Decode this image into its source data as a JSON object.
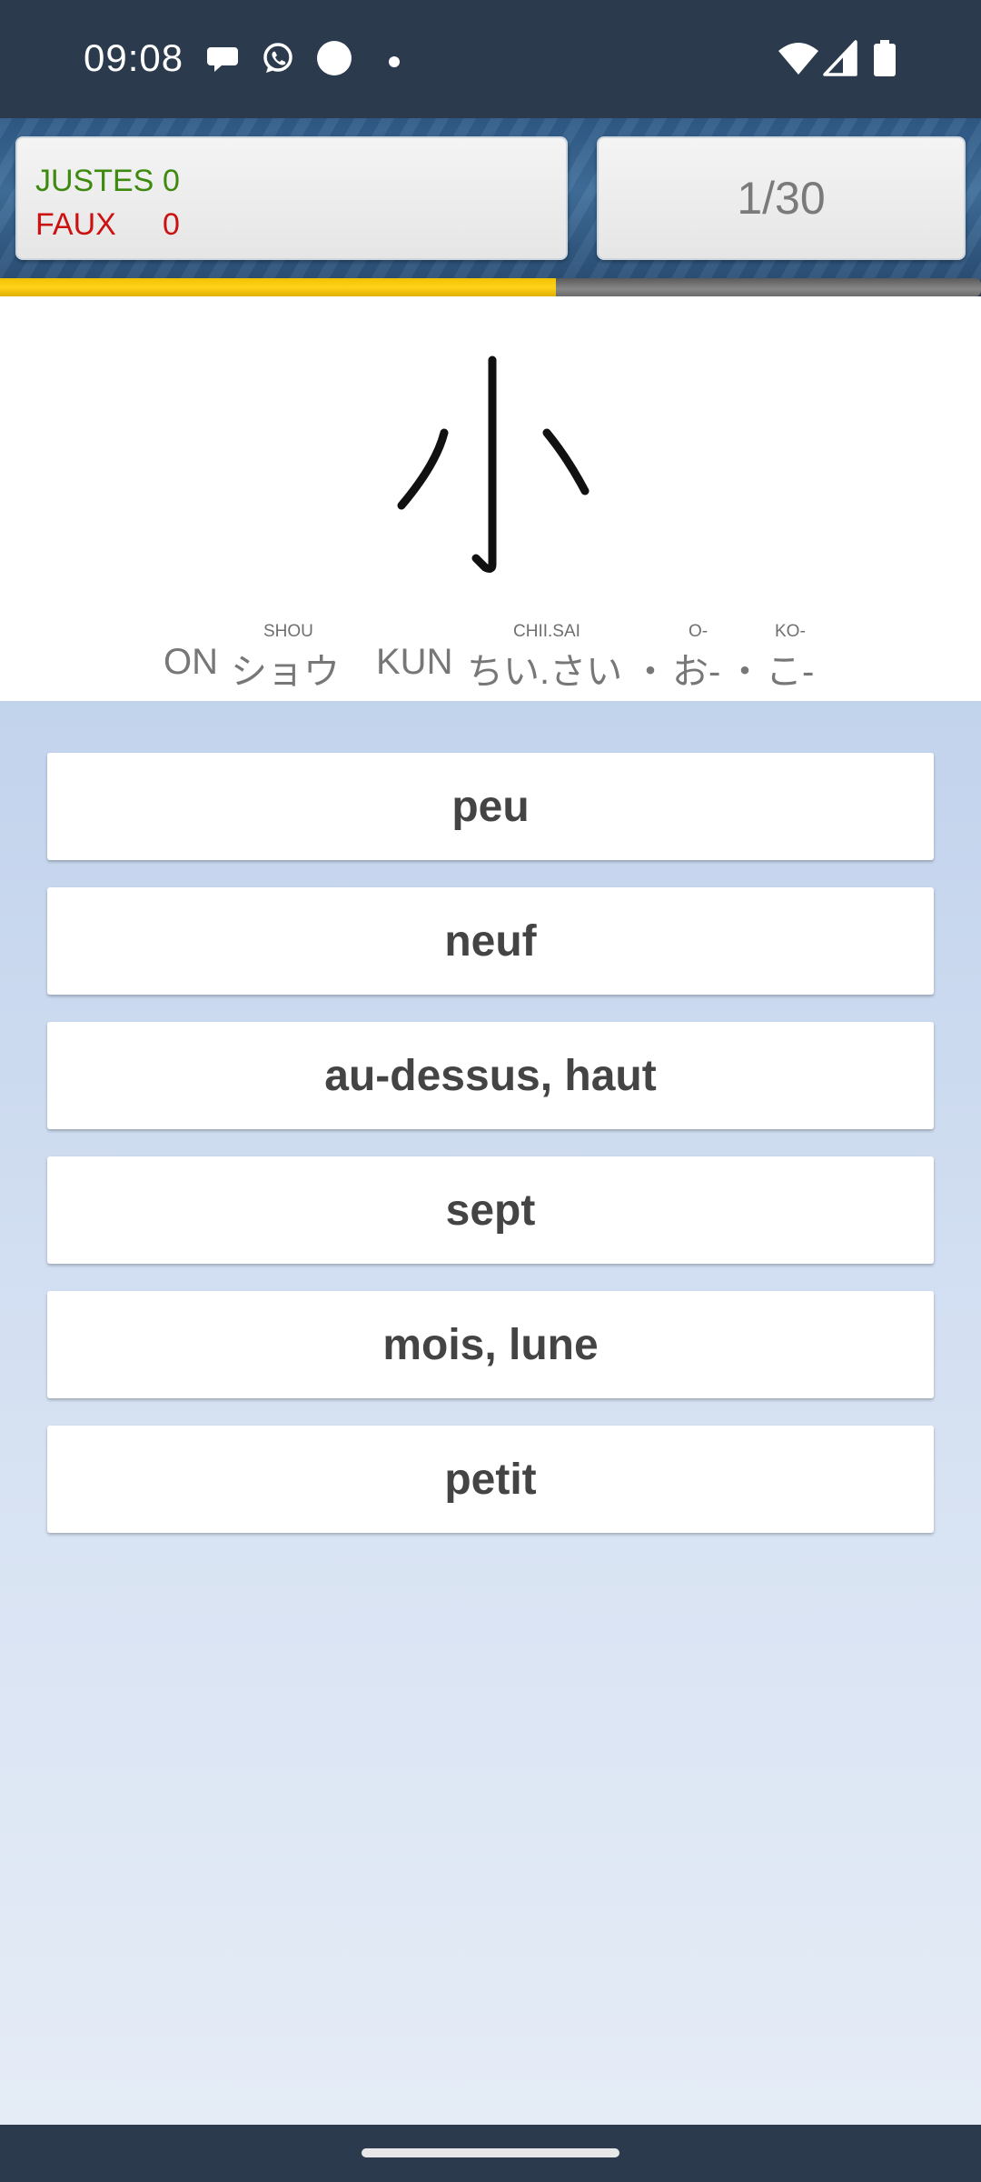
{
  "status_bar": {
    "time": "09:08",
    "left_icons": [
      "chat-bubble-icon",
      "whatsapp-icon",
      "circle-icon",
      "dot-icon"
    ],
    "right_icons": [
      "wifi-icon",
      "signal-icon",
      "battery-icon"
    ]
  },
  "score": {
    "correct_label": "JUSTES",
    "correct_value": "0",
    "wrong_label": "FAUX",
    "wrong_value": "0",
    "correct_color": "#3d8a0f",
    "wrong_color": "#cc1111"
  },
  "progress": {
    "text": "1/30"
  },
  "timer": {
    "remaining_fraction": 0.567,
    "fill_color": "#ffd21a"
  },
  "kanji": {
    "character": "小",
    "on_label": "ON",
    "on_reading": "ショウ",
    "on_romaji": "SHOU",
    "kun_label": "KUN",
    "kun_reading_1": "ちい.さい",
    "kun_romaji_1": "CHII.SAI",
    "separator": "・",
    "kun_reading_2": "お-",
    "kun_romaji_2": "O-",
    "kun_reading_3": "こ-",
    "kun_romaji_3": "KO-"
  },
  "answers": [
    {
      "label": "peu"
    },
    {
      "label": "neuf"
    },
    {
      "label": "au-dessus, haut"
    },
    {
      "label": "sept"
    },
    {
      "label": "mois, lune"
    },
    {
      "label": "petit"
    }
  ]
}
